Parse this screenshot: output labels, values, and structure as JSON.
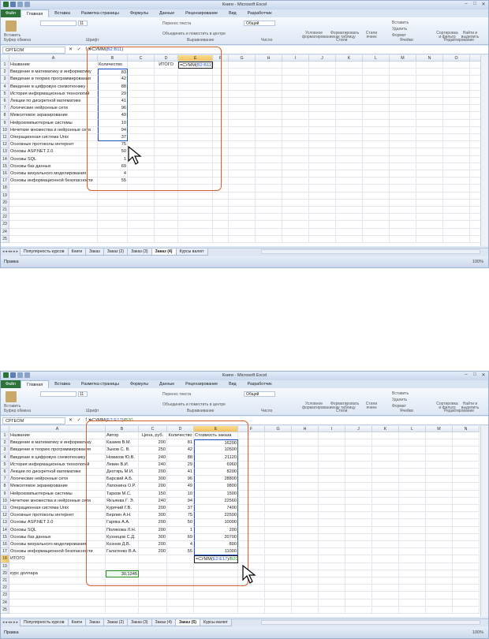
{
  "app": {
    "title": "Книги - Microsoft Excel",
    "file_tab": "Файл",
    "tabs": [
      "Главная",
      "Вставка",
      "Разметка страницы",
      "Формулы",
      "Данные",
      "Рецензирование",
      "Вид",
      "Разработчик"
    ],
    "ribbon": {
      "paste": "Вставить",
      "clipboard": "Буфер обмена",
      "font": "Шрифт",
      "font_size": "11",
      "alignment": "Выравнивание",
      "wrap_text": "Перенос текста",
      "merge": "Объединить и поместить в центре",
      "number": "Число",
      "number_format": "Общий",
      "styles": "Стили",
      "conditional": "Условное форматирование",
      "format_table": "Форматировать как таблицу",
      "cell_styles": "Стили ячеек",
      "cells": "Ячейки",
      "insert": "Вставить",
      "delete": "Удалить",
      "format": "Формат",
      "editing": "Редактирование",
      "sort": "Сортировка и фильтр",
      "find": "Найти и выделить"
    },
    "fx_buttons": "✕ ✓ fx",
    "status_ready": "Правка",
    "zoom": "100%"
  },
  "window1": {
    "name_box": "СРГЕОМ",
    "formula": "=СУММ(B2:B11)",
    "columns": [
      "A",
      "B",
      "C",
      "D",
      "E",
      "F",
      "G",
      "H",
      "I",
      "J",
      "K",
      "L",
      "M",
      "N",
      "O",
      "P"
    ],
    "row_numbers": [
      "1",
      "2",
      "3",
      "4",
      "5",
      "6",
      "7",
      "8",
      "9",
      "10",
      "11",
      "12",
      "13",
      "14",
      "15",
      "16",
      "17",
      "18",
      "19",
      "20",
      "21",
      "22",
      "23",
      "24",
      "25"
    ],
    "header_name": "Название",
    "header_qty": "Количество",
    "itogo": "ИТОГО",
    "edit_formula": "=СУММ(B2:B11)",
    "rows": [
      {
        "name": "Введение в математику и информатику",
        "qty": "83"
      },
      {
        "name": "Введение в теорию программирования",
        "qty": "42"
      },
      {
        "name": "Введение в цифровую схемотехнику",
        "qty": "88"
      },
      {
        "name": "История информационных технологий",
        "qty": "29"
      },
      {
        "name": "Лекции по дискретной математике",
        "qty": "41"
      },
      {
        "name": "Логические нейронные сети",
        "qty": "96"
      },
      {
        "name": "Межсетевое экранирование",
        "qty": "49"
      },
      {
        "name": "Нейрокомпьютерные системы",
        "qty": "10"
      },
      {
        "name": "Нечеткие множества и нейронные сети",
        "qty": "94"
      },
      {
        "name": "Операционная система Unix",
        "qty": "37"
      },
      {
        "name": "Основные протоколы интернет",
        "qty": "75"
      },
      {
        "name": "Основы ASP.NET 2.0",
        "qty": "50"
      },
      {
        "name": "Основы SQL",
        "qty": "1"
      },
      {
        "name": "Основы баз данных",
        "qty": "69"
      },
      {
        "name": "Основы визуального моделирования",
        "qty": "4"
      },
      {
        "name": "Основы информационной безопасности",
        "qty": "55"
      }
    ],
    "sheets": [
      "Популярность курсов",
      "Книги",
      "Заказ",
      "Заказ (2)",
      "Заказ (3)",
      "Заказ (4)",
      "Курсы валют"
    ],
    "active_sheet": "Заказ (4)"
  },
  "window2": {
    "name_box": "СРГЕОМ",
    "formula": "=СУММ(E2:E17)/B20",
    "columns": [
      "A",
      "B",
      "C",
      "D",
      "E",
      "F",
      "G",
      "H",
      "I",
      "J",
      "K",
      "L",
      "M",
      "N"
    ],
    "row_numbers": [
      "1",
      "2",
      "3",
      "4",
      "5",
      "6",
      "7",
      "8",
      "9",
      "10",
      "11",
      "12",
      "13",
      "14",
      "15",
      "16",
      "17",
      "18",
      "19",
      "20",
      "21",
      "22",
      "23",
      "24",
      "25"
    ],
    "headers": {
      "name": "Название",
      "author": "Автор",
      "price": "Цена, руб.",
      "qty": "Количество",
      "cost": "Стоимость заказа"
    },
    "itogo": "ИТОГО",
    "edit_formula": "=СУММ(E2:E17)/B20",
    "dollar_label": "курс доллара",
    "dollar_value": "30,1245",
    "rows": [
      {
        "name": "Введение в математику и информатику",
        "author": "Казиев В.М.",
        "price": "200",
        "qty": "81",
        "cost": "16200"
      },
      {
        "name": "Введение в теорию программирования",
        "author": "Зыков С. В.",
        "price": "250",
        "qty": "42",
        "cost": "10500"
      },
      {
        "name": "Введение в цифровую схемотехнику",
        "author": "Новиков Ю.В.",
        "price": "240",
        "qty": "88",
        "cost": "21120"
      },
      {
        "name": "История информационных технологий",
        "author": "Левин В.И.",
        "price": "240",
        "qty": "29",
        "cost": "6960"
      },
      {
        "name": "Лекции по дискретной математике",
        "author": "Дехтярь М.И.",
        "price": "200",
        "qty": "41",
        "cost": "8200"
      },
      {
        "name": "Логические нейронные сети",
        "author": "Барский А.Б.",
        "price": "300",
        "qty": "96",
        "cost": "28800"
      },
      {
        "name": "Межсетевое экранирование",
        "author": "Лапонина О.Р.",
        "price": "200",
        "qty": "49",
        "cost": "9800"
      },
      {
        "name": "Нейрокомпьютерные системы",
        "author": "Тарков М.С.",
        "price": "150",
        "qty": "10",
        "cost": "1500"
      },
      {
        "name": "Нечеткие множества и нейронные сети",
        "author": "Яхъяева Г. Э.",
        "price": "240",
        "qty": "94",
        "cost": "22560"
      },
      {
        "name": "Операционная система Unix",
        "author": "Курячий Г.В.",
        "price": "200",
        "qty": "37",
        "cost": "7400"
      },
      {
        "name": "Основные протоколы интернет",
        "author": "Берлин А.Н.",
        "price": "300",
        "qty": "75",
        "cost": "22500"
      },
      {
        "name": "Основы ASP.NET 2.0",
        "author": "Гаряка А.А.",
        "price": "200",
        "qty": "50",
        "cost": "10000"
      },
      {
        "name": "Основы SQL",
        "author": "Полякова Л.Н.",
        "price": "200",
        "qty": "1",
        "cost": "200"
      },
      {
        "name": "Основы баз данных",
        "author": "Кузнецов С.Д.",
        "price": "300",
        "qty": "69",
        "cost": "20700"
      },
      {
        "name": "Основы визуального моделирования",
        "author": "Кознов Д.В.",
        "price": "200",
        "qty": "4",
        "cost": "800"
      },
      {
        "name": "Основы информационной безопасности",
        "author": "Галатенко В.А.",
        "price": "200",
        "qty": "55",
        "cost": "11000"
      }
    ],
    "sheets": [
      "Популярность курсов",
      "Книги",
      "Заказ",
      "Заказ (2)",
      "Заказ (3)",
      "Заказ (4)",
      "Заказ (5)",
      "Курсы валют"
    ],
    "active_sheet": "Заказ (5)"
  }
}
